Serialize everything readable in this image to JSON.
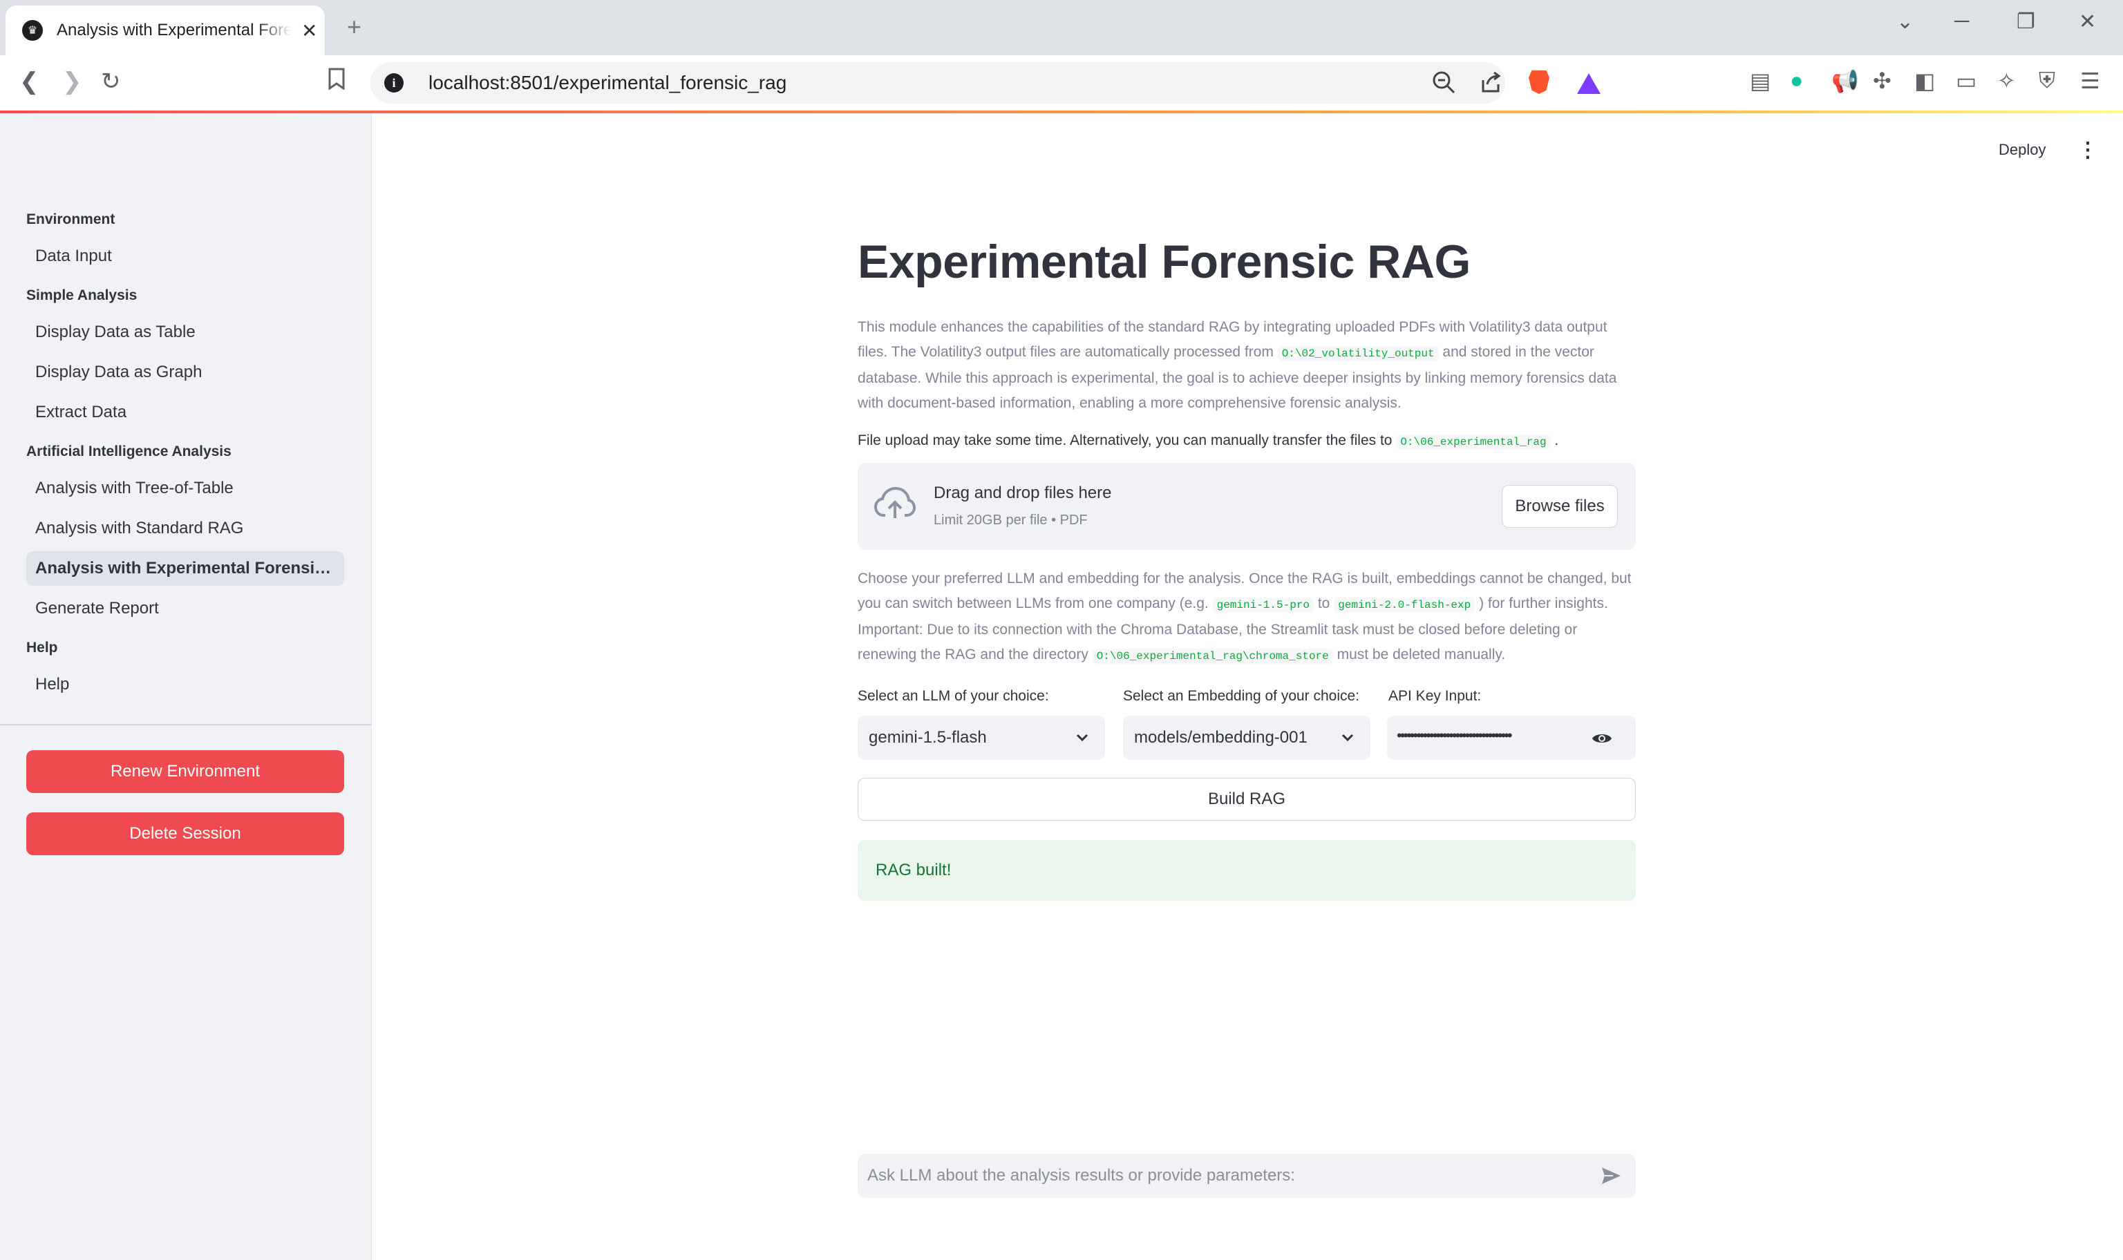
{
  "browser": {
    "tab_title": "Analysis with Experimental Forensic RAG",
    "url_host": "localhost",
    "url_rest": ":8501/experimental_forensic_rag",
    "icons": [
      "back-icon",
      "forward-icon",
      "reload-icon",
      "bookmark-icon",
      "zoom-icon",
      "share-icon",
      "brave-shield-icon",
      "brave-rewards-icon",
      "reader-icon",
      "grammarly-icon",
      "megaphone-icon",
      "extensions-icon",
      "sidebar-icon",
      "wallet-icon",
      "leo-icon",
      "vpn-icon",
      "menu-icon"
    ]
  },
  "header": {
    "deploy_label": "Deploy"
  },
  "sidebar": {
    "sections": [
      {
        "title": "Environment",
        "items": [
          "Data Input"
        ]
      },
      {
        "title": "Simple Analysis",
        "items": [
          "Display Data as Table",
          "Display Data as Graph",
          "Extract Data"
        ]
      },
      {
        "title": "Artificial Intelligence Analysis",
        "items": [
          "Analysis with Tree-of-Table",
          "Analysis with Standard RAG",
          "Analysis with Experimental Forensic RAG",
          "Generate Report"
        ]
      },
      {
        "title": "Help",
        "items": [
          "Help"
        ]
      }
    ],
    "active_item": "Analysis with Experimental Forensic RAG",
    "renew_label": "Renew Environment",
    "delete_label": "Delete Session",
    "accent_color": "#ef4a4f"
  },
  "main": {
    "title": "Experimental Forensic RAG",
    "intro": {
      "p1": "This module enhances the capabilities of the standard RAG by integrating uploaded PDFs with Volatility3 data output files. The Volatility3 output files are automatically processed from ",
      "code1": "O:\\02_volatility_output",
      "p2": " and stored in the vector database. While this approach is experimental, the goal is to achieve deeper insights by linking memory forensics data with document-based information, enabling a more comprehensive forensic analysis."
    },
    "upload_notice": {
      "text": "File upload may take some time. Alternatively, you can manually transfer the files to ",
      "code": "O:\\06_experimental_rag",
      "suffix": " ."
    },
    "dropzone": {
      "title": "Drag and drop files here",
      "limit": "Limit 20GB per file • PDF",
      "browse_label": "Browse files"
    },
    "choose_text": {
      "p1": "Choose your preferred LLM and embedding for the analysis. Once the RAG is built, embeddings cannot be changed, but you can switch between LLMs from one company (e.g. ",
      "code1": "gemini-1.5-pro",
      "mid": " to ",
      "code2": "gemini-2.0-flash-exp",
      "p2": " ) for further insights. Important: Due to its connection with the Chroma Database, the Streamlit task must be closed before deleting or renewing the RAG and the directory ",
      "code3": "O:\\06_experimental_rag\\chroma_store",
      "p3": " must be deleted manually."
    },
    "llm_label": "Select an LLM of your choice:",
    "llm_value": "gemini-1.5-flash",
    "embedding_label": "Select an Embedding of your choice:",
    "embedding_value": "models/embedding-001",
    "api_label": "API Key Input:",
    "api_masked": "•••••••••••••••••••••••••••••••••••",
    "build_label": "Build RAG",
    "success_text": "RAG built!",
    "chat_placeholder": "Ask LLM about the analysis results or provide parameters:"
  }
}
